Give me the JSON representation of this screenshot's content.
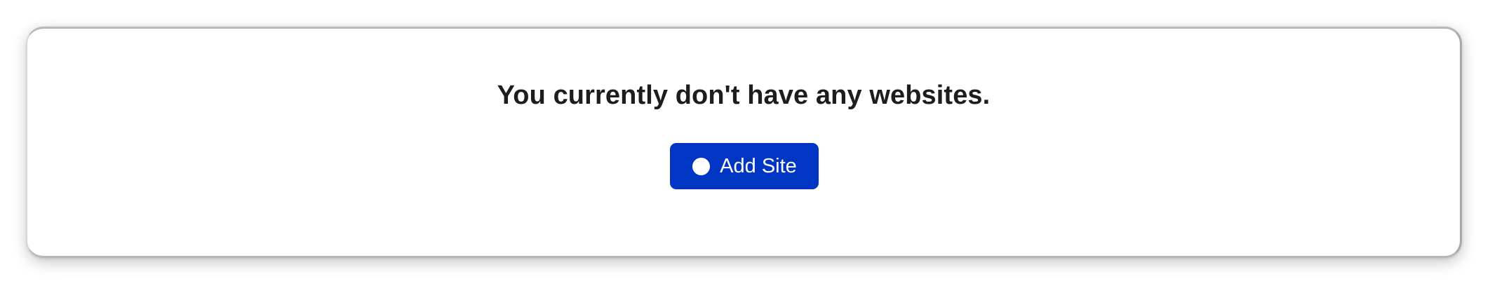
{
  "empty_state": {
    "message": "You currently don't have any websites."
  },
  "add_site_button": {
    "label": "Add Site",
    "icon": "plus-circle-icon",
    "background_color": "#0036c3",
    "text_color": "#ffffff"
  }
}
